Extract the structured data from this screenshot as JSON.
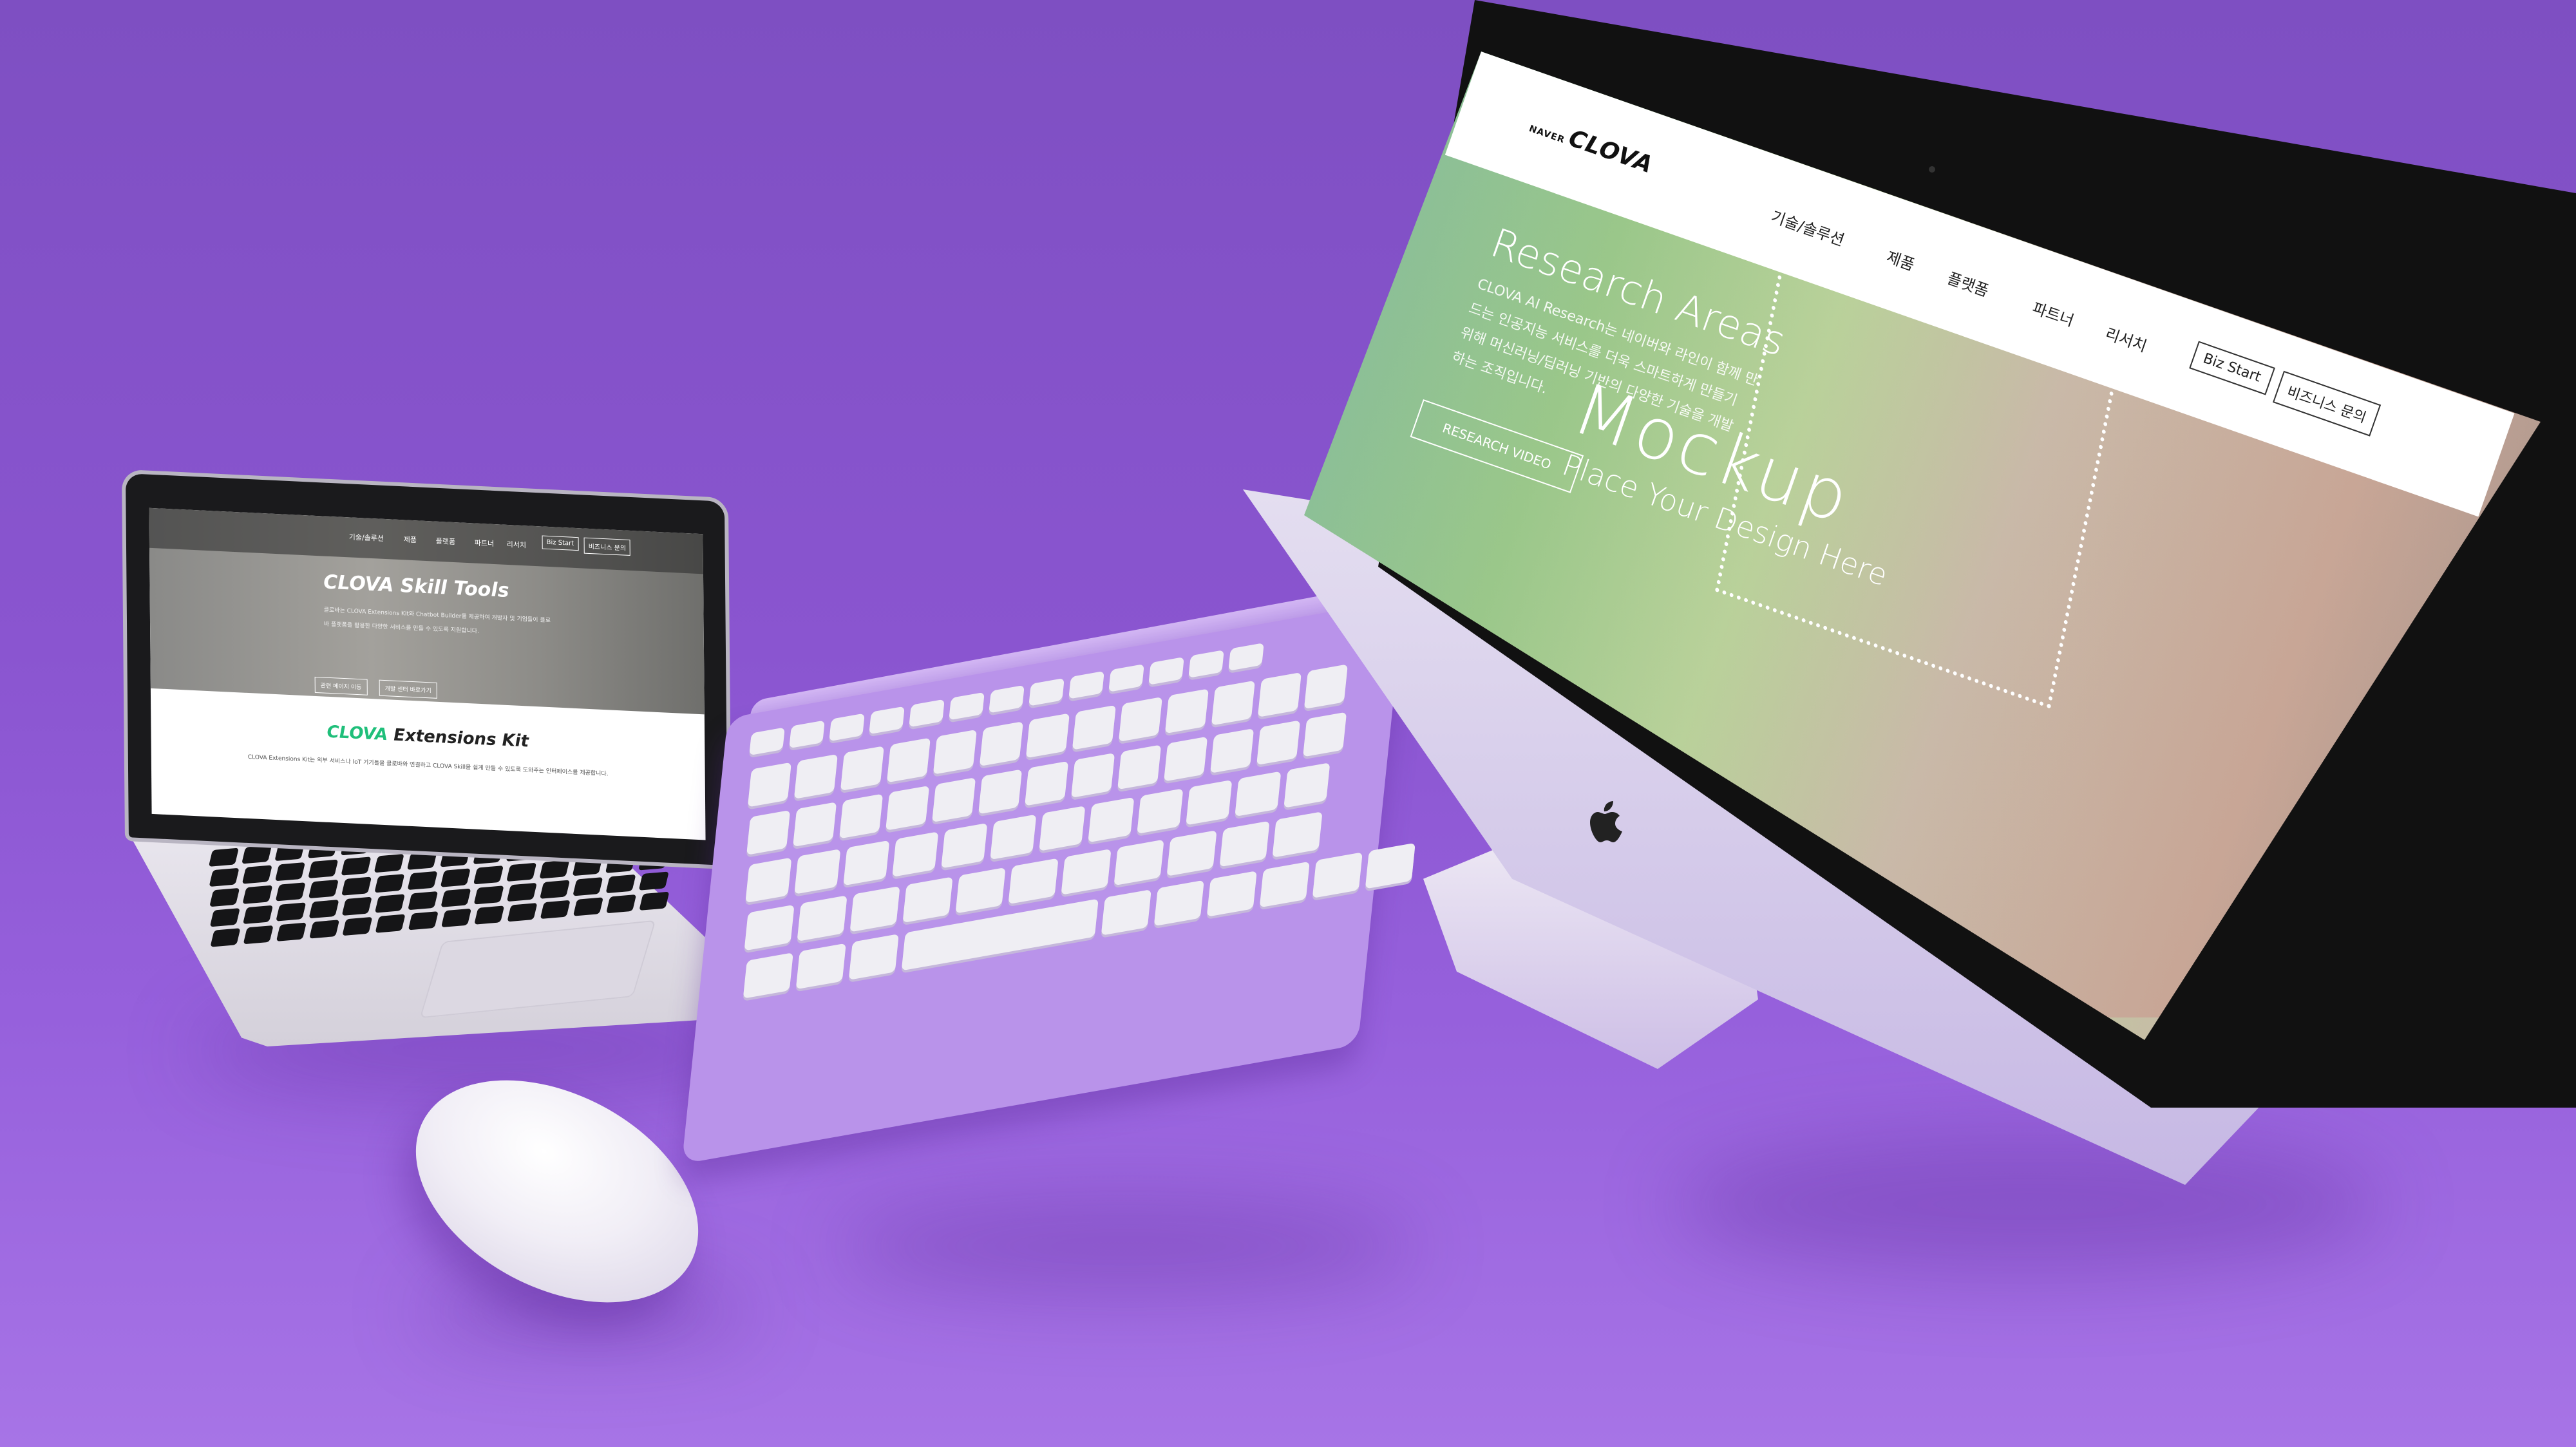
{
  "laptop": {
    "nav": {
      "items": [
        "기술/솔루션",
        "제품",
        "플랫폼",
        "파트너",
        "리서치"
      ],
      "biz_start": "Biz Start",
      "biz_contact": "비즈니스 문의"
    },
    "hero": {
      "title": "CLOVA Skill Tools",
      "description": "클로바는 CLOVA Extensions Kit와 Chatbot Builder를 제공하여 개발자 및 기업들이 클로바 플랫폼을 활용한 다양한 서비스를 만들 수 있도록 지원합니다.",
      "button1": "관련 페이지 이동",
      "button2": "개발 센터 바로가기"
    },
    "section": {
      "brand": "CLOVA",
      "title_rest": "Extensions Kit",
      "description": "CLOVA Extensions Kit는 외부 서비스나 IoT 기기들을 클로바와 연결하고 CLOVA Skill을 쉽게 만들 수 있도록 도와주는 인터페이스를 제공합니다."
    }
  },
  "imac": {
    "logo_small": "NAVER",
    "logo_big": "CLOVA",
    "nav": [
      "기술/솔루션",
      "제품",
      "플랫폼",
      "파트너",
      "리서치"
    ],
    "biz_start": "Biz Start",
    "biz_contact": "비즈니스 문의",
    "hero": {
      "title": "Research Areas",
      "description": "CLOVA AI Research는 네이버와 라인이 함께 만드는 인공지능 서비스를 더욱 스마트하게 만들기 위해 머신러닝/딥러닝 기반의 다양한 기술을 개발하는 조직입니다.",
      "button": "RESEARCH VIDEO"
    },
    "mockup": {
      "title": "Mockup",
      "subtitle": "Place Your Design Here"
    }
  },
  "colors": {
    "background": "#8a55d0",
    "keyboard": "#b993ea",
    "brand_green": "#1fbf7a"
  },
  "icons": [
    "apple-logo-icon"
  ]
}
